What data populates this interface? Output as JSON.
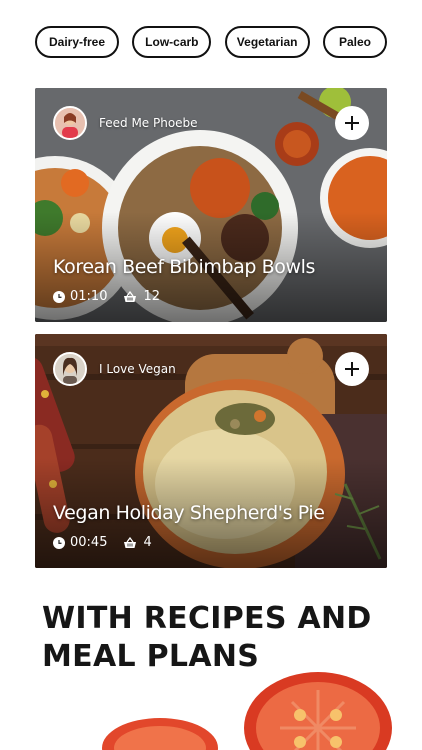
{
  "filters": [
    "Dairy-free",
    "Low-carb",
    "Vegetarian",
    "Paleo"
  ],
  "recipes": [
    {
      "author": "Feed Me Phoebe",
      "title": "Korean Beef Bibimbap Bowls",
      "time": "01:10",
      "servings": "12",
      "add_icon": "plus-icon"
    },
    {
      "author": "I Love Vegan",
      "title": "Vegan Holiday Shepherd's Pie",
      "time": "00:45",
      "servings": "4",
      "add_icon": "plus-icon"
    }
  ],
  "headline": {
    "line1": "WITH RECIPES AND",
    "line2": "MEAL PLANS"
  },
  "colors": {
    "accent": "#111111",
    "tomato": "#e2472b"
  }
}
